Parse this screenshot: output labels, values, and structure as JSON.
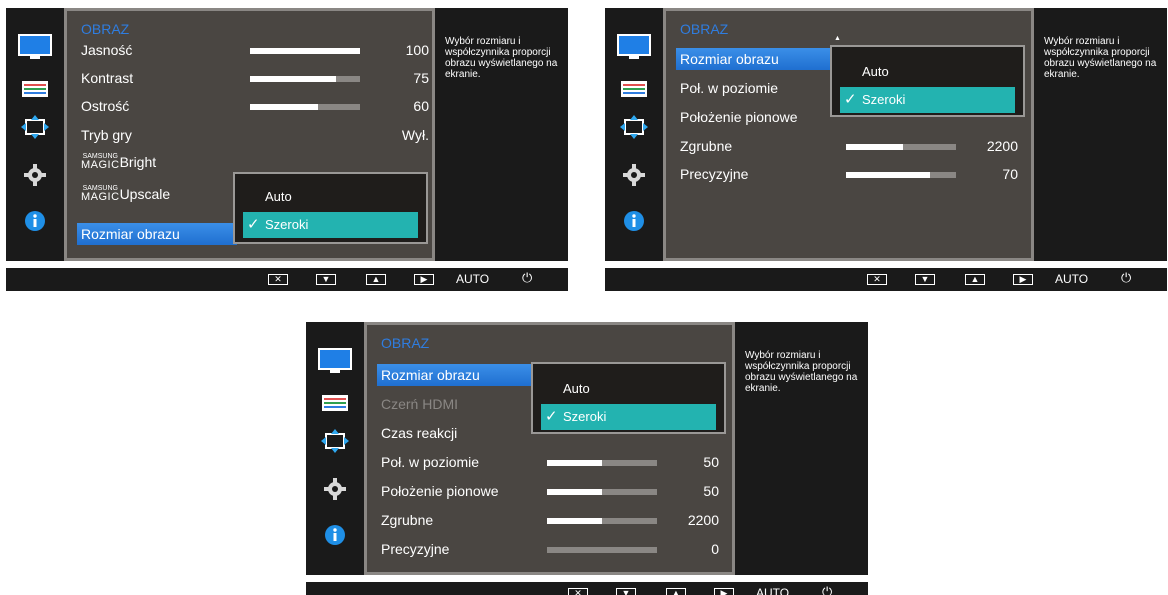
{
  "desc_text": "Wybór rozmiaru i współczynnika proporcji obrazu wyświetlanego na ekranie.",
  "menu_title": "OBRAZ",
  "bottom": {
    "close": "✕",
    "down": "▼",
    "up": "▲",
    "enter": "▶",
    "auto": "AUTO",
    "power": "⏻"
  },
  "icons": [
    "monitor-icon",
    "color-settings-icon",
    "size-position-icon",
    "gear-icon",
    "info-icon"
  ],
  "colors": {
    "accent_blue": "#2f7de0",
    "selection": "#23b3b0",
    "menu_bg": "#4a4642",
    "panel_bg": "#1a1a1a"
  },
  "screens": [
    {
      "items": [
        {
          "label": "Jasność",
          "value": "100",
          "bar": 1.0
        },
        {
          "label": "Kontrast",
          "value": "75",
          "bar": 0.78
        },
        {
          "label": "Ostrość",
          "value": "60",
          "bar": 0.62
        },
        {
          "label": "Tryb gry",
          "value": "Wył."
        },
        {
          "magic_top": "SAMSUNG",
          "magic_mid": "MAGIC",
          "label": "Bright"
        },
        {
          "magic_top": "SAMSUNG",
          "magic_mid": "MAGIC",
          "label": "Upscale"
        },
        {
          "label": "Rozmiar obrazu",
          "selected": true
        }
      ],
      "popup": {
        "options": [
          "Auto",
          "Szeroki"
        ],
        "selected": "Szeroki"
      }
    },
    {
      "items": [
        {
          "label": "Rozmiar obrazu",
          "selected": true
        },
        {
          "label": "Poł. w poziomie"
        },
        {
          "label": "Położenie pionowe"
        },
        {
          "label": "Zgrubne",
          "value": "2200",
          "bar": 0.52
        },
        {
          "label": "Precyzyjne",
          "value": "70",
          "bar": 0.76
        }
      ],
      "popup": {
        "options": [
          "Auto",
          "Szeroki"
        ],
        "selected": "Szeroki"
      }
    },
    {
      "items": [
        {
          "label": "Rozmiar obrazu",
          "selected": true
        },
        {
          "label": "Czerń HDMI",
          "disabled": true
        },
        {
          "label": "Czas reakcji"
        },
        {
          "label": "Poł. w poziomie",
          "value": "50",
          "bar": 0.5
        },
        {
          "label": "Położenie pionowe",
          "value": "50",
          "bar": 0.5
        },
        {
          "label": "Zgrubne",
          "value": "2200",
          "bar": 0.5
        },
        {
          "label": "Precyzyjne",
          "value": "0",
          "bar": 0.0
        }
      ],
      "popup": {
        "options": [
          "Auto",
          "Szeroki"
        ],
        "selected": "Szeroki"
      }
    }
  ]
}
